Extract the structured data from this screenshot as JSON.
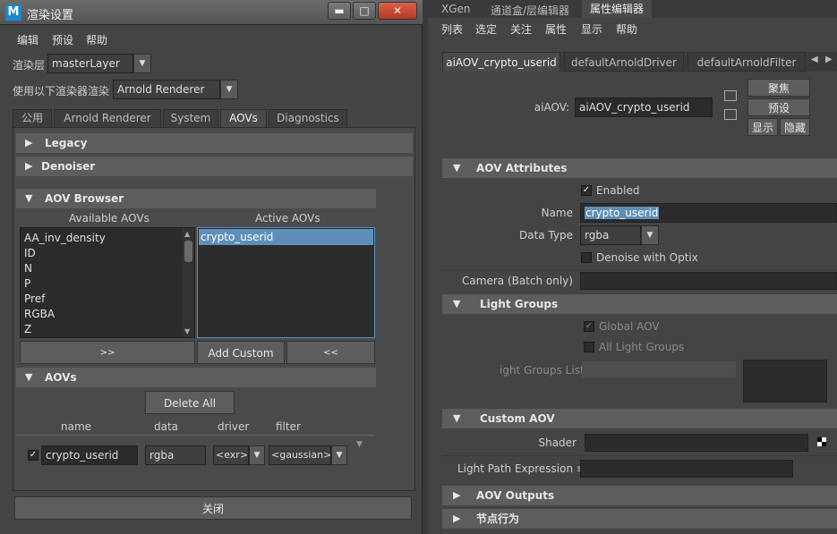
{
  "dialog": {
    "title": "渲染设置",
    "app_icon": "M",
    "window_buttons": {
      "minimize": "▬",
      "maximize": "□",
      "close": "✕"
    },
    "menu": [
      "编辑",
      "预设",
      "帮助"
    ],
    "render_layer_label": "渲染层",
    "render_layer_value": "masterLayer",
    "renderer_label": "使用以下渲染器渲染",
    "renderer_value": "Arnold Renderer",
    "tabs": [
      "公用",
      "Arnold Renderer",
      "System",
      "AOVs",
      "Diagnostics"
    ],
    "active_tab": "AOVs",
    "sections": {
      "legacy": "Legacy",
      "denoiser": "Denoiser",
      "aov_browser": "AOV Browser",
      "aovs": "AOVs"
    },
    "available_label": "Available AOVs",
    "active_label": "Active AOVs",
    "available_aovs": [
      "AA_inv_density",
      "ID",
      "N",
      "P",
      "Pref",
      "RGBA",
      "Z"
    ],
    "active_aovs": [
      "crypto_userid"
    ],
    "buttons": {
      "add": ">>",
      "add_custom": "Add Custom",
      "remove": "<<",
      "delete_all": "Delete All",
      "close": "关闭"
    },
    "table_headers": [
      "name",
      "data",
      "driver",
      "filter"
    ],
    "aov_row": {
      "name": "crypto_userid",
      "data": "rgba",
      "driver": "<exr>",
      "filter": "<gaussian>"
    }
  },
  "editor": {
    "top_tabs": [
      "XGen",
      "通道盒/层编辑器",
      "属性编辑器"
    ],
    "active_top_tab": "属性编辑器",
    "menu": [
      "列表",
      "选定",
      "关注",
      "属性",
      "显示",
      "帮助"
    ],
    "node_tabs": [
      "aiAOV_crypto_userid",
      "defaultArnoldDriver",
      "defaultArnoldFilter"
    ],
    "node_label": "aiAOV:",
    "node_value": "aiAOV_crypto_userid",
    "side_buttons": {
      "focus": "聚焦",
      "presets": "预设",
      "show": "显示",
      "hide": "隐藏"
    },
    "sections": {
      "aov_attributes": "AOV Attributes",
      "light_groups": "Light Groups",
      "custom_aov": "Custom AOV",
      "aov_outputs": "AOV Outputs",
      "node_behavior": "节点行为"
    },
    "enabled_label": "Enabled",
    "name_label": "Name",
    "name_value": "crypto_userid",
    "data_type_label": "Data Type",
    "data_type_value": "rgba",
    "denoise_label": "Denoise with Optix",
    "camera_label": "Camera (Batch only)",
    "global_aov_label": "Global AOV",
    "all_light_groups_label": "All Light Groups",
    "light_groups_list_label": "ight Groups List",
    "shader_label": "Shader",
    "lpe_label": "Light Path Expression ≡"
  }
}
